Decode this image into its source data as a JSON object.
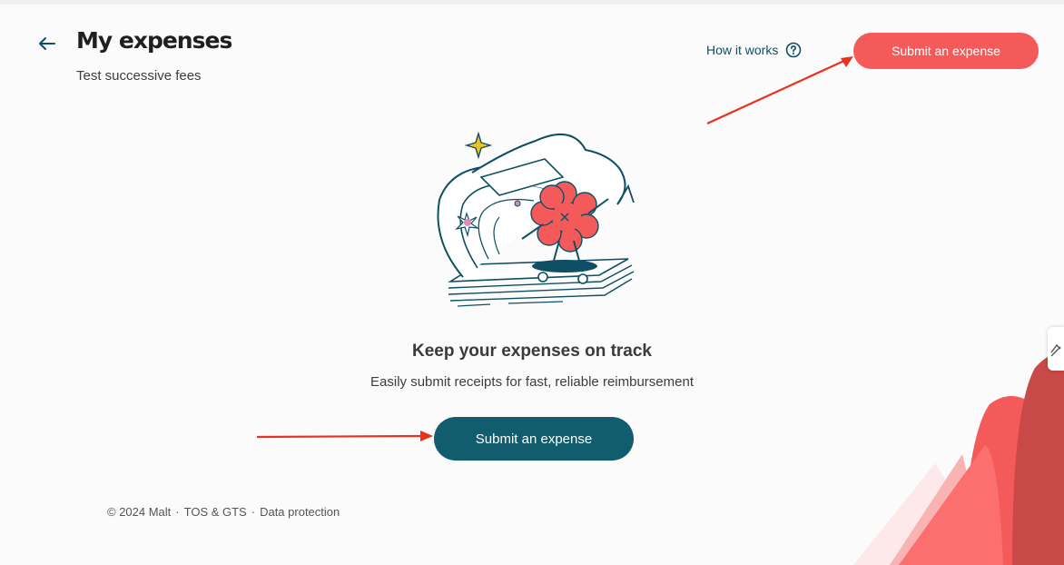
{
  "header": {
    "title": "My expenses",
    "subtitle": "Test successive fees",
    "back_icon": "arrow-left-icon"
  },
  "help": {
    "label": "How it works",
    "icon": "question-circle-icon"
  },
  "buttons": {
    "submit_top": "Submit an expense",
    "submit_main": "Submit an expense"
  },
  "empty_state": {
    "heading": "Keep your expenses on track",
    "description": "Easily submit receipts for fast, reliable reimbursement",
    "illustration": "flower-character-skateboard-illustration"
  },
  "footer": {
    "copyright": "© 2024 Malt",
    "sep1": "·",
    "tos": "TOS & GTS",
    "sep2": "·",
    "data_protection": "Data protection"
  },
  "colors": {
    "primary_coral": "#f45a5a",
    "primary_teal": "#115c6d",
    "annotation_red": "#e8321c",
    "text_dark": "#1f1f1f"
  }
}
